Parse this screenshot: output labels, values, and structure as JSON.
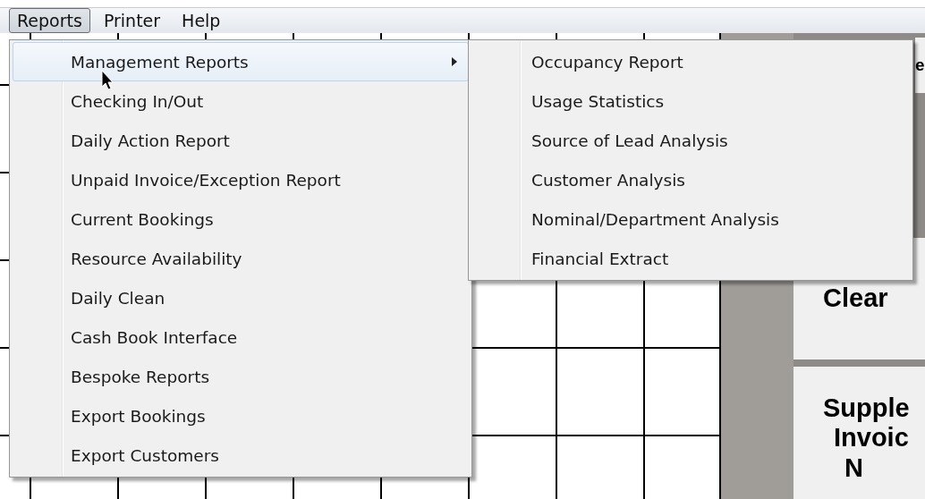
{
  "menubar": [
    {
      "label": "Reports",
      "selected": true
    },
    {
      "label": "Printer",
      "selected": false
    },
    {
      "label": "Help",
      "selected": false
    }
  ],
  "menu": {
    "items": [
      {
        "label": "Management Reports",
        "selected": true,
        "has_submenu": true
      },
      {
        "label": "Checking In/Out",
        "selected": false,
        "has_submenu": false
      },
      {
        "label": "Daily Action Report",
        "selected": false,
        "has_submenu": false
      },
      {
        "label": "Unpaid Invoice/Exception Report",
        "selected": false,
        "has_submenu": false
      },
      {
        "label": "Current Bookings",
        "selected": false,
        "has_submenu": false
      },
      {
        "label": "Resource Availability",
        "selected": false,
        "has_submenu": false
      },
      {
        "label": "Daily Clean",
        "selected": false,
        "has_submenu": false
      },
      {
        "label": "Cash Book Interface",
        "selected": false,
        "has_submenu": false
      },
      {
        "label": "Bespoke Reports",
        "selected": false,
        "has_submenu": false
      },
      {
        "label": "Export Bookings",
        "selected": false,
        "has_submenu": false
      },
      {
        "label": "Export Customers",
        "selected": false,
        "has_submenu": false
      }
    ]
  },
  "submenu": {
    "items": [
      {
        "label": "Occupancy Report"
      },
      {
        "label": "Usage Statistics"
      },
      {
        "label": "Source of Lead Analysis"
      },
      {
        "label": "Customer Analysis"
      },
      {
        "label": "Nominal/Department Analysis"
      },
      {
        "label": "Financial Extract"
      }
    ]
  },
  "side_buttons": [
    {
      "lines": [
        "e"
      ]
    },
    {
      "lines": [
        "Clear"
      ]
    },
    {
      "lines": [
        "Supple",
        "Invoic",
        "N"
      ]
    }
  ]
}
